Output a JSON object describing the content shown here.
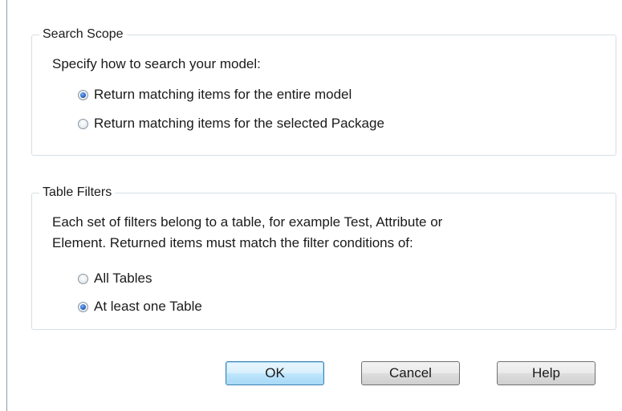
{
  "search_scope": {
    "title": "Search Scope",
    "prompt": "Specify how to search your model:",
    "options": [
      {
        "label": "Return matching items for the entire model",
        "checked": true
      },
      {
        "label": "Return matching items for the selected Package",
        "checked": false
      }
    ]
  },
  "table_filters": {
    "title": "Table Filters",
    "description_line1": "Each set of filters belong to a table, for example Test, Attribute or",
    "description_line2": "Element. Returned items must match the filter conditions of:",
    "options": [
      {
        "label": "All Tables",
        "checked": false
      },
      {
        "label": "At least one Table",
        "checked": true
      }
    ]
  },
  "buttons": {
    "ok": "OK",
    "cancel": "Cancel",
    "help": "Help"
  },
  "colors": {
    "radio_selected": "#2c68c7",
    "default_button_border": "#3c7fb1"
  }
}
